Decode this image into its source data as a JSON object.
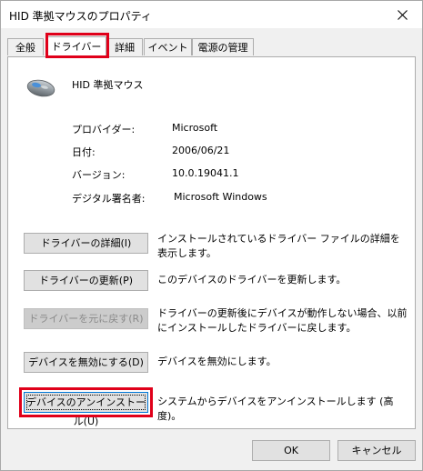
{
  "window": {
    "title": "HID 準拠マウスのプロパティ"
  },
  "tabs": [
    {
      "label": "全般"
    },
    {
      "label": "ドライバー"
    },
    {
      "label": "詳細"
    },
    {
      "label": "イベント"
    },
    {
      "label": "電源の管理"
    }
  ],
  "device": {
    "name": "HID 準拠マウス"
  },
  "properties": [
    {
      "label": "プロバイダー:",
      "value": "Microsoft"
    },
    {
      "label": "日付:",
      "value": "2006/06/21"
    },
    {
      "label": "バージョン:",
      "value": "10.0.19041.1"
    },
    {
      "label": "デジタル署名者:",
      "value": "Microsoft Windows"
    }
  ],
  "actions": [
    {
      "button": "ドライバーの詳細(I)",
      "description": "インストールされているドライバー ファイルの詳細を表示します。"
    },
    {
      "button": "ドライバーの更新(P)",
      "description": "このデバイスのドライバーを更新します。"
    },
    {
      "button": "ドライバーを元に戻す(R)",
      "description": "ドライバーの更新後にデバイスが動作しない場合、以前にインストールしたドライバーに戻します。"
    },
    {
      "button": "デバイスを無効にする(D)",
      "description": "デバイスを無効にします。"
    },
    {
      "button": "デバイスのアンインストール(U)",
      "description": "システムからデバイスをアンインストールします (高度)。"
    }
  ],
  "footer": {
    "ok": "OK",
    "cancel": "キャンセル"
  },
  "colors": {
    "highlight": "#e0001a",
    "focus": "#0078d7"
  }
}
